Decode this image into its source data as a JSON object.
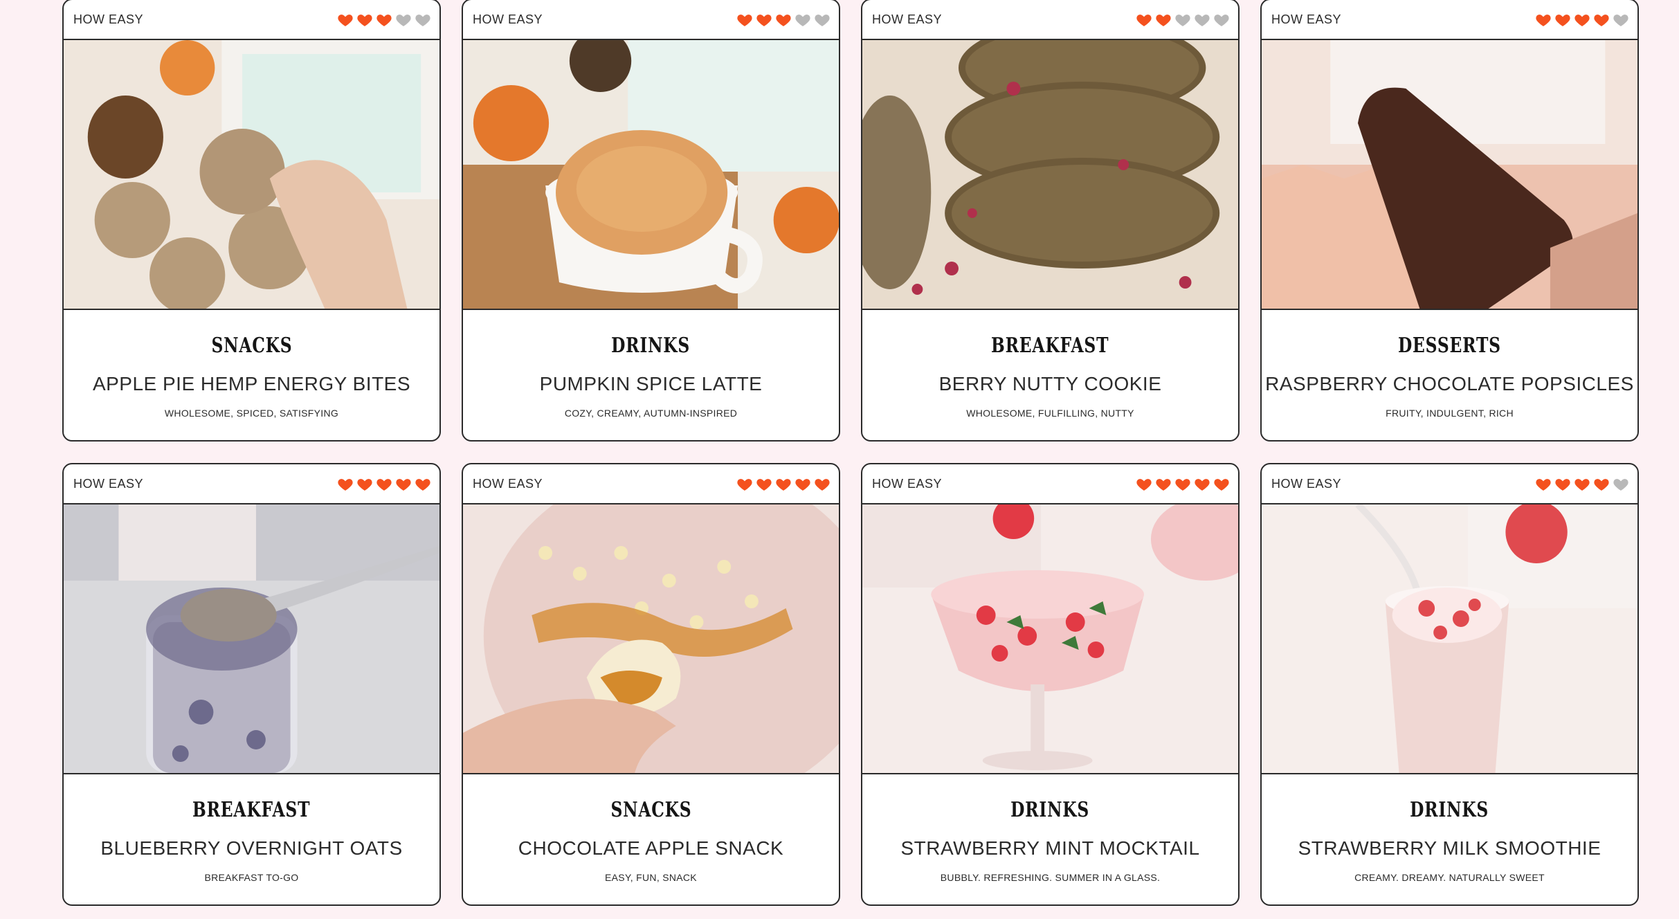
{
  "how_easy_label": "HOW EASY",
  "colors": {
    "heart_filled": "#f4511e",
    "heart_empty": "#b8b8b8",
    "border": "#2b2b2b",
    "page_bg": "#fdf1f4"
  },
  "max_hearts": 5,
  "recipes": [
    {
      "category": "SNACKS",
      "title": "APPLE PIE HEMP ENERGY BITES",
      "tagline": "WHOLESOME, SPICED, SATISFYING",
      "ease": 3,
      "photo_icon": "energy-bites-photo",
      "palette": [
        "#efe6dc",
        "#d9c3a7",
        "#8b6a45",
        "#e7c4ab"
      ]
    },
    {
      "category": "DRINKS",
      "title": "PUMPKIN SPICE LATTE",
      "tagline": "COZY, CREAMY, AUTUMN-INSPIRED",
      "ease": 3,
      "photo_icon": "latte-photo",
      "palette": [
        "#efe9e0",
        "#b98452",
        "#e0a062",
        "#e4782c"
      ]
    },
    {
      "category": "BREAKFAST",
      "title": "BERRY NUTTY COOKIE",
      "tagline": "WHOLESOME, FULFILLING, NUTTY",
      "ease": 2,
      "photo_icon": "cookie-stack-photo",
      "palette": [
        "#e8dccd",
        "#6e5a3a",
        "#8c7650",
        "#b0304c"
      ]
    },
    {
      "category": "DESSERTS",
      "title": "RASPBERRY CHOCOLATE POPSICLES",
      "tagline": "FRUITY, INDULGENT, RICH",
      "ease": 4,
      "photo_icon": "popsicle-photo",
      "palette": [
        "#f3e4dc",
        "#e8a58b",
        "#4a281d",
        "#f0c0a8"
      ]
    },
    {
      "category": "BREAKFAST",
      "title": "BLUEBERRY OVERNIGHT OATS",
      "tagline": "BREAKFAST TO-GO",
      "ease": 5,
      "photo_icon": "overnight-oats-photo",
      "palette": [
        "#d9d9dc",
        "#b7b4c4",
        "#6d6a8c",
        "#9a8f86"
      ]
    },
    {
      "category": "SNACKS",
      "title": "CHOCOLATE APPLE SNACK",
      "tagline": "EASY, FUN, SNACK",
      "ease": 5,
      "photo_icon": "apple-snack-photo",
      "palette": [
        "#f1e4e0",
        "#e9cfc9",
        "#d48a2c",
        "#f4e7b8"
      ]
    },
    {
      "category": "DRINKS",
      "title": "STRAWBERRY MINT MOCKTAIL",
      "tagline": "BUBBLY. REFRESHING. SUMMER IN A GLASS.",
      "ease": 5,
      "photo_icon": "mocktail-photo",
      "palette": [
        "#f5ecea",
        "#f3c6c7",
        "#e23a45",
        "#3f7a3a"
      ]
    },
    {
      "category": "DRINKS",
      "title": "STRAWBERRY MILK SMOOTHIE",
      "tagline": "CREAMY. DREAMY. NATURALLY SWEET",
      "ease": 4,
      "photo_icon": "smoothie-photo",
      "palette": [
        "#f6eeeb",
        "#f0d7d3",
        "#e04a4f",
        "#e8d0cc"
      ]
    }
  ]
}
